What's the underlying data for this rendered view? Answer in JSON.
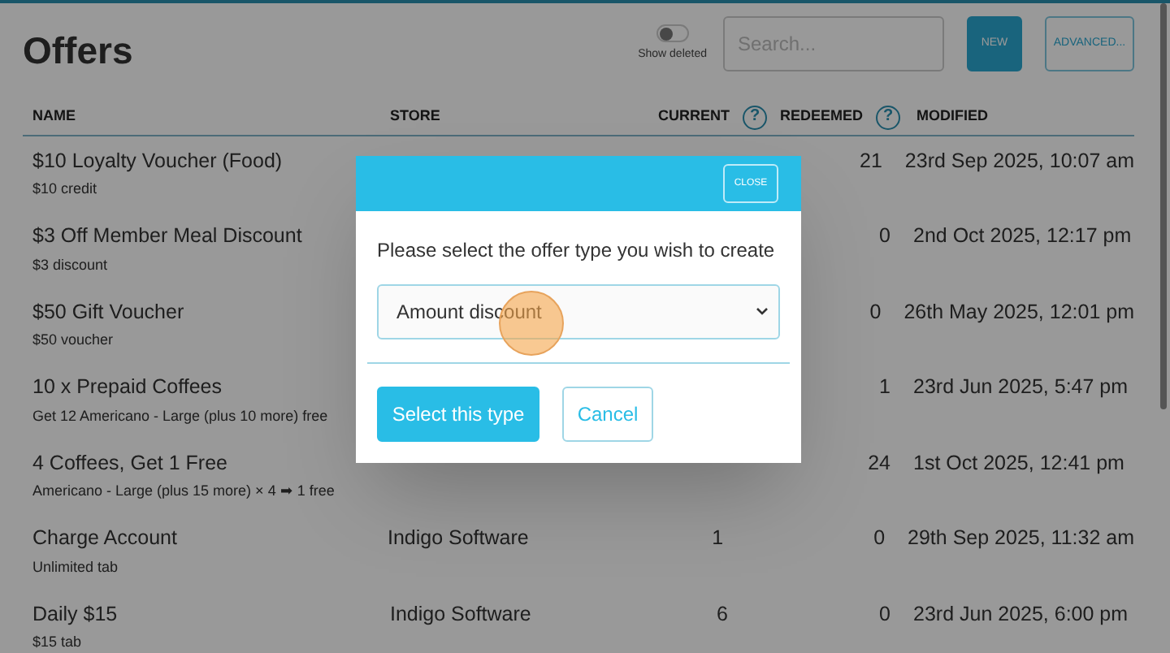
{
  "page": {
    "title": "Offers"
  },
  "toolbar": {
    "show_deleted": {
      "label": "Show deleted",
      "on": false
    },
    "search": {
      "placeholder": "Search..."
    },
    "buttons": [
      {
        "label": "NEW",
        "kind": "primary"
      },
      {
        "label": "ADVANCED...",
        "kind": "outline"
      }
    ]
  },
  "table": {
    "columns": [
      {
        "label": "NAME"
      },
      {
        "label": "STORE"
      },
      {
        "label": "CURRENT",
        "help": "?"
      },
      {
        "label": "REDEEMED",
        "help": "?"
      },
      {
        "label": "MODIFIED"
      }
    ],
    "rows": [
      {
        "name": "$10 Loyalty Voucher (Food)",
        "detail": "$10 credit",
        "redeemed": "21",
        "modified": "23rd Sep 2025, 10:07 am"
      },
      {
        "name": "$3 Off Member Meal Discount",
        "detail": "$3 discount",
        "redeemed": "0",
        "modified": "2nd Oct 2025, 12:17 pm"
      },
      {
        "name": "$50 Gift Voucher",
        "detail": "$50 voucher",
        "redeemed": "0",
        "modified": "26th May 2025, 12:01 pm"
      },
      {
        "name": "10 x Prepaid Coffees",
        "detail": "Get 12 Americano - Large (plus 10 more) free",
        "redeemed": "1",
        "modified": "23rd Jun 2025, 5:47 pm"
      },
      {
        "name": "4 Coffees, Get 1 Free",
        "detail": "Americano - Large (plus 15 more) × 4 ➡ 1 free",
        "redeemed": "24",
        "modified": "1st Oct 2025, 12:41 pm"
      },
      {
        "name": "Charge Account",
        "detail": "Unlimited tab",
        "store": "Indigo Software",
        "current": "1",
        "redeemed": "0",
        "modified": "29th Sep 2025, 11:32 am"
      },
      {
        "name": "Daily $15",
        "detail": "$15 tab",
        "store": "Indigo Software",
        "current": "6",
        "redeemed": "0",
        "modified": "23rd Jun 2025, 6:00 pm"
      }
    ]
  },
  "dialog": {
    "close": "CLOSE",
    "prompt": "Please select the offer type you wish to create",
    "select": {
      "value": "Amount discount"
    },
    "buttons": [
      {
        "label": "Select this type",
        "kind": "primary"
      },
      {
        "label": "Cancel",
        "kind": "outline"
      }
    ]
  }
}
